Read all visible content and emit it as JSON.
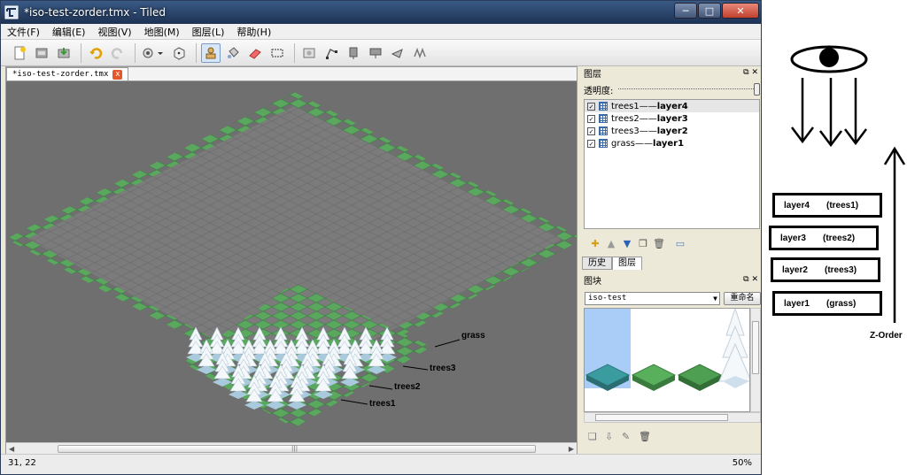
{
  "window": {
    "title": "*iso-test-zorder.tmx - Tiled",
    "minimize": "─",
    "restore": "□",
    "close": "✕"
  },
  "menu": [
    "文件(F)",
    "编辑(E)",
    "视图(V)",
    "地图(M)",
    "图层(L)",
    "帮助(H)"
  ],
  "toolbar": {
    "icons": [
      "new-file-icon",
      "open-file-icon",
      "save-file-icon",
      "undo-icon",
      "redo-icon",
      "command-icon",
      "random-icon",
      "stamp-brush-icon",
      "bucket-fill-icon",
      "eraser-icon",
      "rect-select-icon",
      "insert-image-icon",
      "edit-polygon-icon",
      "insert-rect-icon",
      "insert-ellipse-icon",
      "insert-polygon-icon",
      "insert-polyline-icon"
    ],
    "active": "stamp-brush-icon"
  },
  "document_tab": {
    "label": "*iso-test-zorder.tmx",
    "close": "x"
  },
  "map_labels": {
    "grass": "grass",
    "trees3": "trees3",
    "trees2": "trees2",
    "trees1": "trees1"
  },
  "status": {
    "coords": "31, 22",
    "zoom": "50%"
  },
  "layers_panel": {
    "title": "图层",
    "opacity_label": "透明度:",
    "opacity_value": 1.0,
    "rows": [
      {
        "name": "trees1",
        "dash": "——",
        "note": "layer4",
        "checked": true,
        "selected": true
      },
      {
        "name": "trees2",
        "dash": "——",
        "note": "layer3",
        "checked": true,
        "selected": false
      },
      {
        "name": "trees3",
        "dash": "——",
        "note": "layer2",
        "checked": true,
        "selected": false
      },
      {
        "name": "grass",
        "dash": "——",
        "note": "layer1",
        "checked": true,
        "selected": false
      }
    ],
    "tools": [
      "new-layer-icon",
      "move-layer-up-icon",
      "move-layer-down-icon",
      "duplicate-layer-icon",
      "delete-layer-icon",
      "layer-properties-icon"
    ]
  },
  "dock_tabs": [
    "历史",
    "图层"
  ],
  "tileset_panel": {
    "title": "图块",
    "selected_tileset": "iso-test",
    "rename_button": "重命名"
  },
  "annotation": {
    "boxes": [
      {
        "layer": "layer4",
        "name": "(trees1)"
      },
      {
        "layer": "layer3",
        "name": "(trees2)"
      },
      {
        "layer": "layer2",
        "name": "(trees3)"
      },
      {
        "layer": "layer1",
        "name": "(grass)"
      }
    ],
    "axis_label": "Z-Order"
  },
  "colors": {
    "canvas_bg": "#6f6f6f",
    "grass_green": "#5aa85e",
    "grid_gray": "#7b7b7b",
    "selection_blue": "#a9cdf6"
  }
}
